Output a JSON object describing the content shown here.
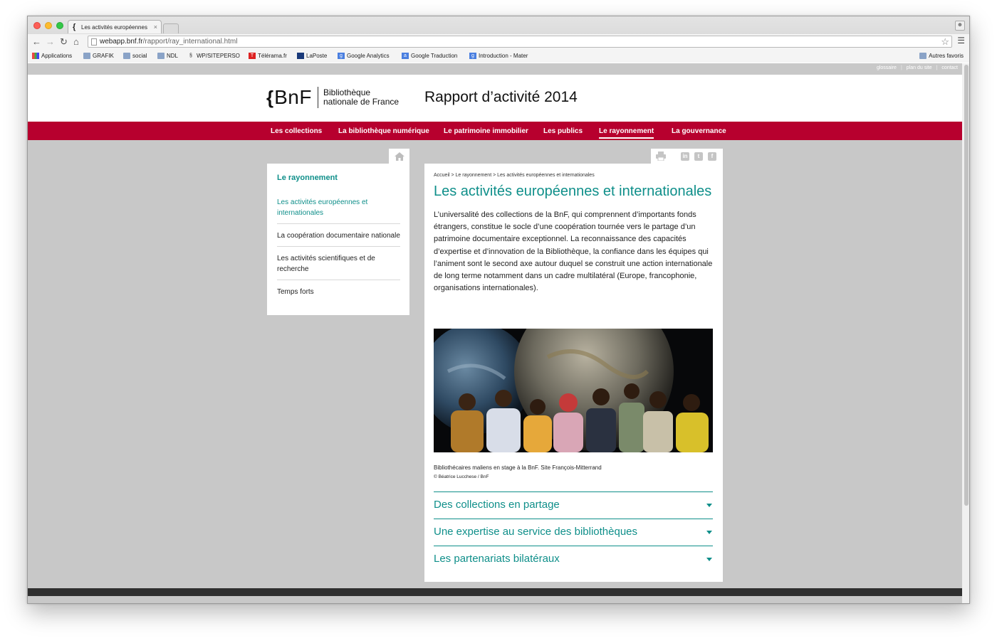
{
  "browser": {
    "tab_title": "Les activités européennes",
    "tab_close": "×",
    "url_host": "webapp.bnf.fr",
    "url_path": "/rapport/ray_international.html",
    "bookmarks": [
      "Applications",
      "GRAFIK",
      "social",
      "NDL",
      "WP/SITEPERSO",
      "Télérama.fr",
      "LaPoste",
      "Google Analytics",
      "Google Traduction",
      "Introduction - Mater"
    ],
    "other_bookmarks": "Autres favoris"
  },
  "site": {
    "util_links": [
      "glossaire",
      "plan du site",
      "contact"
    ],
    "util_sep": "|",
    "logo_brace": "{",
    "logo_text": "BnF",
    "logo_name_line1": "Bibliothèque",
    "logo_name_line2": "nationale de France",
    "report_title": "Rapport d’activité 2014",
    "nav": [
      "Les collections",
      "La bibliothèque numérique",
      "Le patrimoine immobilier",
      "Les publics",
      "Le rayonnement",
      "La gouvernance"
    ],
    "nav_active": "Le rayonnement"
  },
  "sidebar": {
    "title": "Le rayonnement",
    "items": [
      "Les activités européennes et internationales",
      "La coopération documentaire nationale",
      "Les activités scientifiques et de recherche",
      "Temps forts"
    ]
  },
  "content": {
    "breadcrumb": "Accueil > Le rayonnement > Les activités européennes et internationales",
    "title": "Les activités européennes et internationales",
    "intro": "L’universalité des collections de la BnF, qui comprennent d’importants fonds étrangers, constitue le socle d’une coopération tournée vers le partage d’un patrimoine documentaire exceptionnel. La reconnaissance des capacités d’expertise et d’innovation de la Bibliothèque, la confiance dans les équipes qui l’animent sont le second axe autour duquel se construit une action internationale de long terme notamment dans un cadre multilatéral (Europe, francophonie, organisations internationales).",
    "caption": "Bibliothécaires maliens en stage à la BnF. Site François-Mitterrand",
    "credit": "© Béatrice Lucchese / BnF",
    "sections": [
      "Des collections en partage",
      "Une expertise au service des bibliothèques",
      "Les partenariats bilatéraux"
    ],
    "share_icons": [
      "in",
      "t",
      "f"
    ]
  },
  "colors": {
    "brand_red": "#b7002e",
    "teal": "#0f8f8a",
    "page_gray": "#c8c8c8"
  }
}
